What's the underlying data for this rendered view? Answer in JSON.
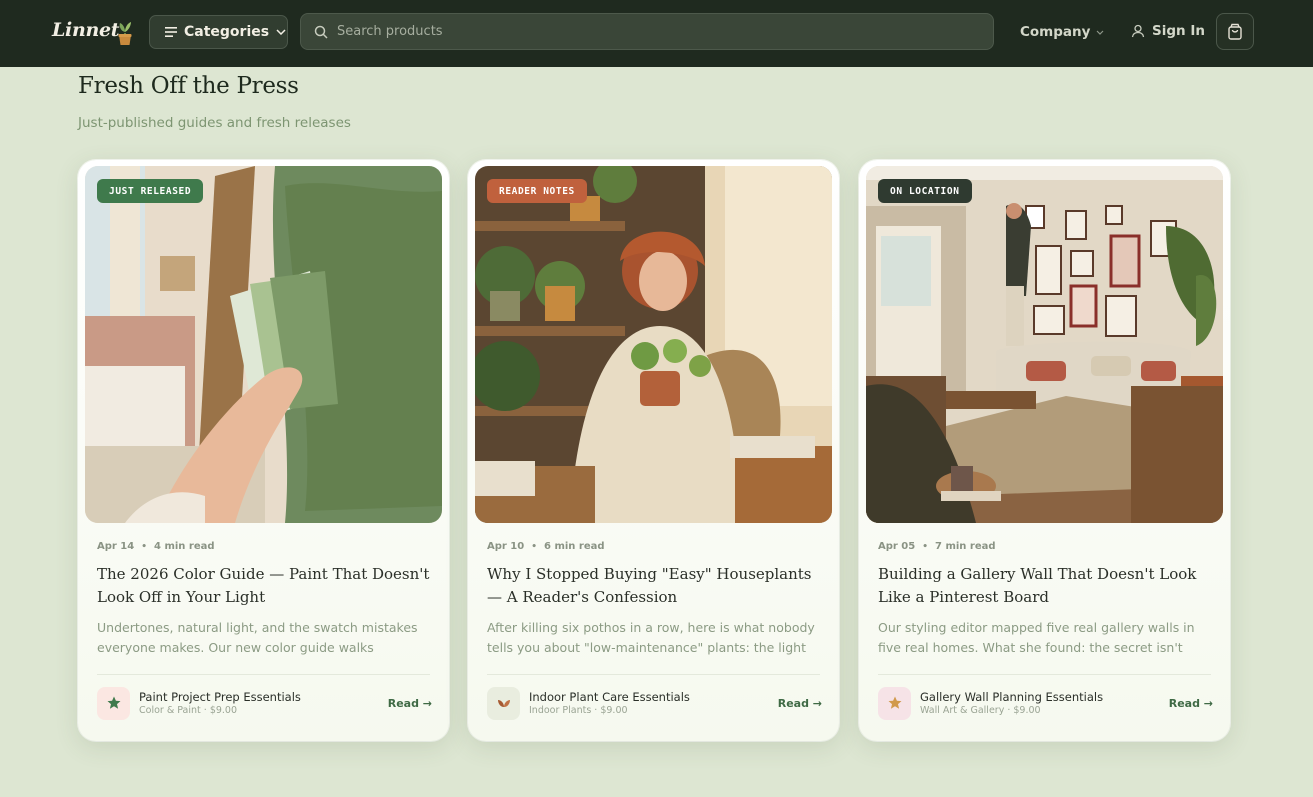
{
  "header": {
    "logo_text": "Linnet",
    "categories_label": "Categories",
    "search_placeholder": "Search products",
    "company_label": "Company",
    "signin_label": "Sign In"
  },
  "section": {
    "title": "Fresh Off the Press",
    "subtitle": "Just-published guides and fresh releases"
  },
  "cards": [
    {
      "tag": "JUST RELEASED",
      "tag_color": "#3f7a4c",
      "date": "Apr 14",
      "read_time": "4 min read",
      "title": "The 2026 Color Guide — Paint That Doesn't Look Off in Your Light",
      "excerpt": "Undertones, natural light, and the swatch mistakes everyone makes. Our new color guide walks through...",
      "product_name": "Paint Project Prep Essentials",
      "product_meta": "Color & Paint · $9.00",
      "product_icon": "star-icon",
      "product_thumb_color": "#fbe7e2",
      "read_label": "Read →"
    },
    {
      "tag": "READER NOTES",
      "tag_color": "#c0613d",
      "date": "Apr 10",
      "read_time": "6 min read",
      "title": "Why I Stopped Buying \"Easy\" Houseplants — A Reader's Confession",
      "excerpt": "After killing six pothos in a row, here is what nobody tells you about \"low-maintenance\" plants: the light matters...",
      "product_name": "Indoor Plant Care Essentials",
      "product_meta": "Indoor Plants · $9.00",
      "product_icon": "sprout-icon",
      "product_thumb_color": "#e9eddf",
      "read_label": "Read →"
    },
    {
      "tag": "ON LOCATION",
      "tag_color": "#2f3a30",
      "date": "Apr 05",
      "read_time": "7 min read",
      "title": "Building a Gallery Wall That Doesn't Look Like a Pinterest Board",
      "excerpt": "Our styling editor mapped five real gallery walls in five real homes. What she found: the secret isn't more...",
      "product_name": "Gallery Wall Planning Essentials",
      "product_meta": "Wall Art & Gallery · $9.00",
      "product_icon": "star-icon",
      "product_thumb_color": "#f6e3e7",
      "read_label": "Read →"
    }
  ]
}
